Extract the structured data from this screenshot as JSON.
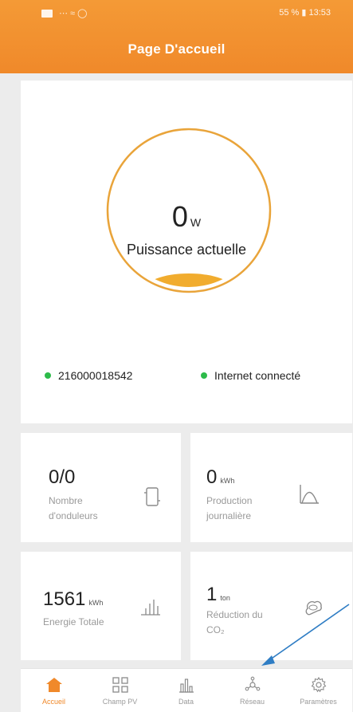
{
  "status_bar": {
    "left_text": "⋯ ≈ ◯",
    "right_text": "55 % ▮ 13:53"
  },
  "header": {
    "title": "Page D'accueil"
  },
  "power": {
    "value": "0",
    "unit": "W",
    "label": "Puissance actuelle",
    "fill_fraction": 0.0
  },
  "status": {
    "serial": "216000018542",
    "internet": "Internet connecté"
  },
  "stats": [
    {
      "value": "0/0",
      "unit": "",
      "label_line1": "Nombre",
      "label_line2": "d'onduleurs",
      "icon": "inverter-icon"
    },
    {
      "value": "0",
      "unit": "kWh",
      "label_line1": "Production",
      "label_line2": "journalière",
      "icon": "production-curve-icon"
    },
    {
      "value": "1561",
      "unit": "kWh",
      "label_line1": "Energie Totale",
      "label_line2": "",
      "icon": "bar-chart-icon"
    },
    {
      "value": "1",
      "unit": "ton",
      "label_line1": "Réduction du",
      "label_line2": "CO₂",
      "icon": "co2-cloud-icon"
    }
  ],
  "nav": [
    {
      "label": "Accueil",
      "icon": "home-icon",
      "active": true
    },
    {
      "label": "Champ PV",
      "icon": "grid-icon",
      "active": false
    },
    {
      "label": "Data",
      "icon": "data-chart-icon",
      "active": false
    },
    {
      "label": "Réseau",
      "icon": "network-icon",
      "active": false
    },
    {
      "label": "Paramètres",
      "icon": "settings-gear-icon",
      "active": false
    }
  ],
  "colors": {
    "accent": "#f0892a",
    "status_green": "#2dbb4a",
    "gauge_ring": "#e9a43a",
    "arrow": "#2f7dc4"
  }
}
